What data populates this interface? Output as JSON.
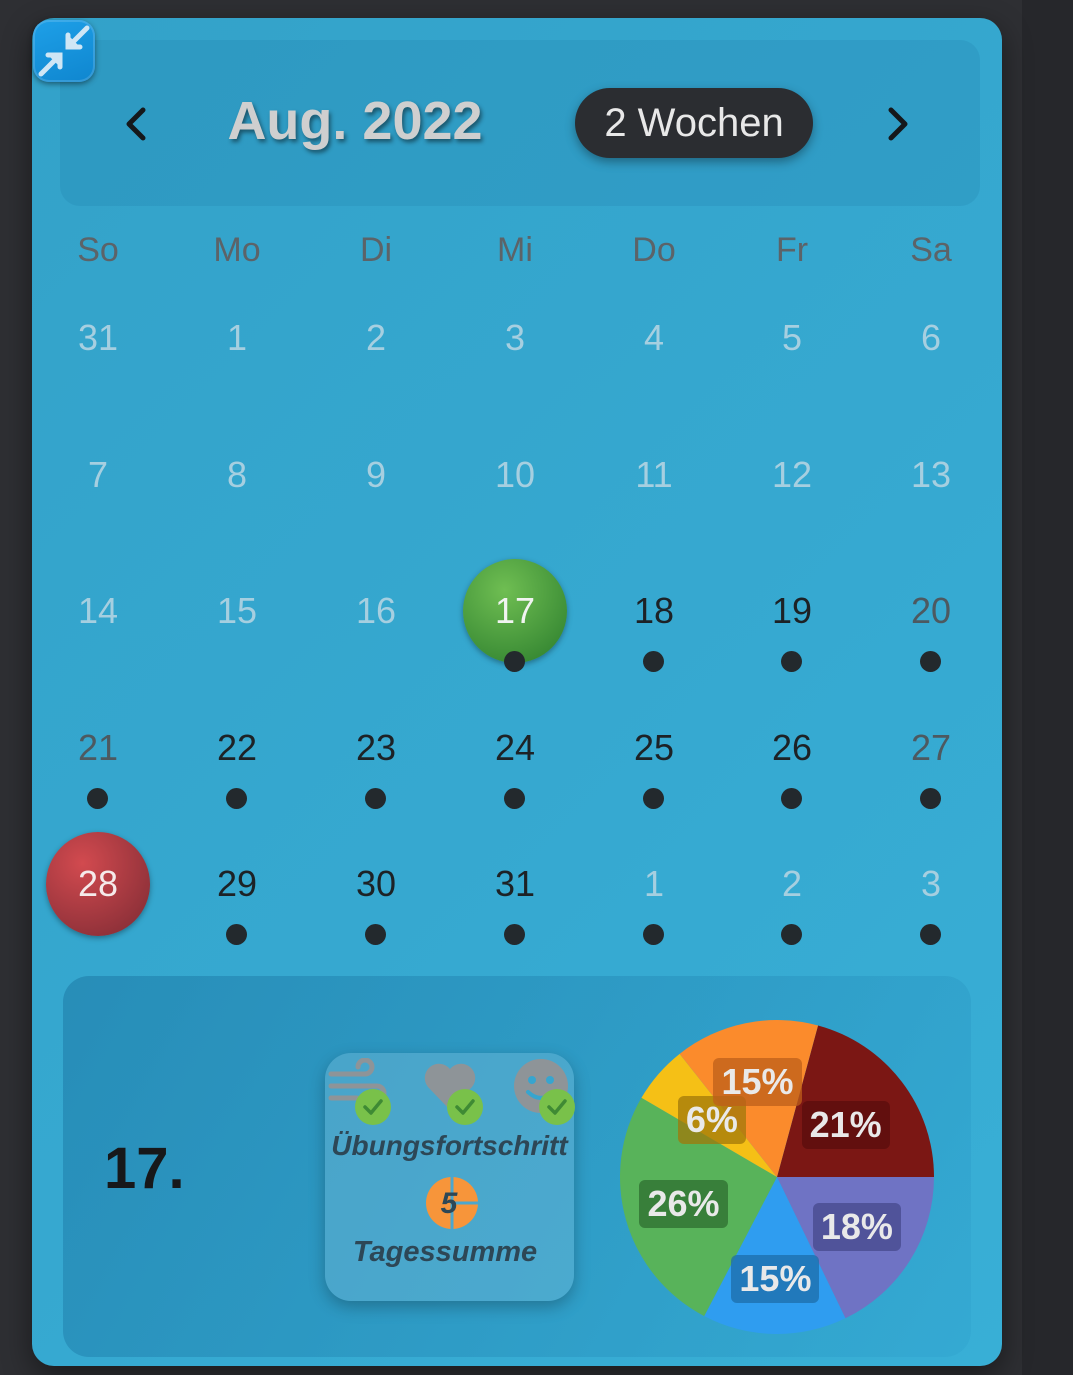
{
  "header": {
    "month_title": "Aug. 2022",
    "view_toggle": "2 Wochen",
    "prev_icon": "chevron-left-icon",
    "next_icon": "chevron-right-icon",
    "collapse_icon": "collapse-arrows-icon"
  },
  "weekdays": [
    "So",
    "Mo",
    "Di",
    "Mi",
    "Do",
    "Fr",
    "Sa"
  ],
  "weeks": [
    [
      {
        "d": "31",
        "s": "muted"
      },
      {
        "d": "1",
        "s": "muted"
      },
      {
        "d": "2",
        "s": "muted"
      },
      {
        "d": "3",
        "s": "muted"
      },
      {
        "d": "4",
        "s": "muted"
      },
      {
        "d": "5",
        "s": "muted"
      },
      {
        "d": "6",
        "s": "muted"
      }
    ],
    [
      {
        "d": "7",
        "s": "muted"
      },
      {
        "d": "8",
        "s": "muted"
      },
      {
        "d": "9",
        "s": "muted"
      },
      {
        "d": "10",
        "s": "muted"
      },
      {
        "d": "11",
        "s": "muted"
      },
      {
        "d": "12",
        "s": "muted"
      },
      {
        "d": "13",
        "s": "muted"
      }
    ],
    [
      {
        "d": "14",
        "s": "muted"
      },
      {
        "d": "15",
        "s": "muted"
      },
      {
        "d": "16",
        "s": "muted"
      },
      {
        "d": "17",
        "s": "today",
        "dot": true
      },
      {
        "d": "18",
        "s": "active",
        "dot": true
      },
      {
        "d": "19",
        "s": "active",
        "dot": true
      },
      {
        "d": "20",
        "s": "weekend-dark",
        "dot": true
      }
    ],
    [
      {
        "d": "21",
        "s": "weekend-dark",
        "dot": true
      },
      {
        "d": "22",
        "s": "active",
        "dot": true
      },
      {
        "d": "23",
        "s": "active",
        "dot": true
      },
      {
        "d": "24",
        "s": "active",
        "dot": true
      },
      {
        "d": "25",
        "s": "active",
        "dot": true
      },
      {
        "d": "26",
        "s": "active",
        "dot": true
      },
      {
        "d": "27",
        "s": "weekend-dark",
        "dot": true
      }
    ],
    [
      {
        "d": "28",
        "s": "selected"
      },
      {
        "d": "29",
        "s": "active",
        "dot": true
      },
      {
        "d": "30",
        "s": "active",
        "dot": true
      },
      {
        "d": "31",
        "s": "active",
        "dot": true
      },
      {
        "d": "1",
        "s": "muted",
        "dot": true
      },
      {
        "d": "2",
        "s": "muted",
        "dot": true
      },
      {
        "d": "3",
        "s": "muted",
        "dot": true
      }
    ]
  ],
  "detail": {
    "date_label": "17.",
    "progress_title": "Übungsfortschritt",
    "exercise_icons": [
      "wind-icon",
      "heart-icon",
      "smiley-icon"
    ],
    "sum_value": "5",
    "sum_label": "Tagessumme"
  },
  "chart_data": {
    "type": "pie",
    "slices": [
      {
        "label": "21%",
        "value": 21,
        "color": "#7b1714"
      },
      {
        "label": "18%",
        "value": 18,
        "color": "#6f73c4"
      },
      {
        "label": "15%",
        "value": 15,
        "color": "#2f9df0"
      },
      {
        "label": "26%",
        "value": 26,
        "color": "#58b35a"
      },
      {
        "label": "6%",
        "value": 6,
        "color": "#f5c016"
      },
      {
        "label": "15%",
        "value": 15,
        "color": "#fb8b2c"
      }
    ]
  }
}
